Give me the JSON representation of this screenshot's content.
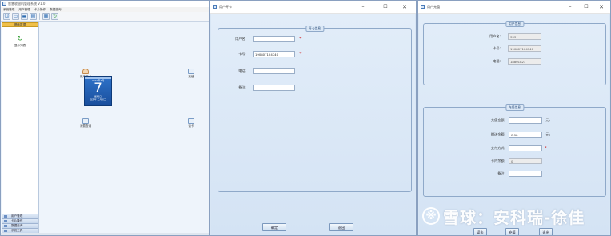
{
  "main_window": {
    "title": "智慧收银机管理系统 V1.0",
    "menu": [
      "系统管理",
      "用户管理",
      "卡片操作",
      "数据查询"
    ],
    "toolbar_icons": [
      "user-icon",
      "card-icon",
      "card-icon",
      "report-icon",
      "calculator-icon",
      "refresh-icon"
    ],
    "sidebar": {
      "header": "基础数据",
      "refresh_label": "显示列表",
      "bottom_items": [
        "用户管理",
        "卡片操作",
        "数据查询",
        "系统工具"
      ]
    },
    "workspace_icons": [
      {
        "name": "open-card-icon",
        "label": "用户开卡"
      },
      {
        "name": "recharge-icon",
        "label": "充值"
      },
      {
        "name": "query-icon",
        "label": "消费查询"
      },
      {
        "name": "read-card-icon",
        "label": "读卡"
      }
    ],
    "calendar": {
      "year_month": "2019年4月",
      "day": "7",
      "weekday": "星期日",
      "lunar": "己亥年 三月初三"
    }
  },
  "open_card_dialog": {
    "title": "用户开卡",
    "group_title": "开卡信息",
    "fields": [
      {
        "label": "用户名:",
        "value": "",
        "required": true
      },
      {
        "label": "卡号:",
        "value": "190807104740",
        "required": true
      },
      {
        "label": "电话:",
        "value": "",
        "required": false
      },
      {
        "label": "备注:",
        "value": "",
        "required": false
      }
    ],
    "confirm_label": "确定",
    "exit_label": "退出"
  },
  "recharge_dialog": {
    "title": "用户充值",
    "info_group_title": "用户信息",
    "info_fields": [
      {
        "label": "用户名:",
        "value": "333"
      },
      {
        "label": "卡号:",
        "value": "190807104740"
      },
      {
        "label": "电话:",
        "value": "18801823"
      }
    ],
    "recharge_group_title": "充值信息",
    "recharge_fields": [
      {
        "label": "充值金额:",
        "value": "",
        "unit": "(元)",
        "readonly": false,
        "required": false
      },
      {
        "label": "赠送金额:",
        "value": "0.00",
        "unit": "(元)",
        "readonly": false,
        "required": false
      },
      {
        "label": "支付方式:",
        "value": "",
        "unit": "",
        "readonly": false,
        "required": true
      },
      {
        "label": "卡内余额:",
        "value": "0",
        "unit": "",
        "readonly": true,
        "required": false
      },
      {
        "label": "备注:",
        "value": "",
        "unit": "",
        "readonly": false,
        "required": false
      }
    ],
    "buttons": [
      "读卡",
      "充值",
      "退出"
    ]
  },
  "watermark": {
    "text": "雪球：安科瑞-徐佳"
  },
  "colors": {
    "accent": "#2e72c9",
    "required": "#d00000",
    "sidebar_header": "#f0c04a"
  }
}
